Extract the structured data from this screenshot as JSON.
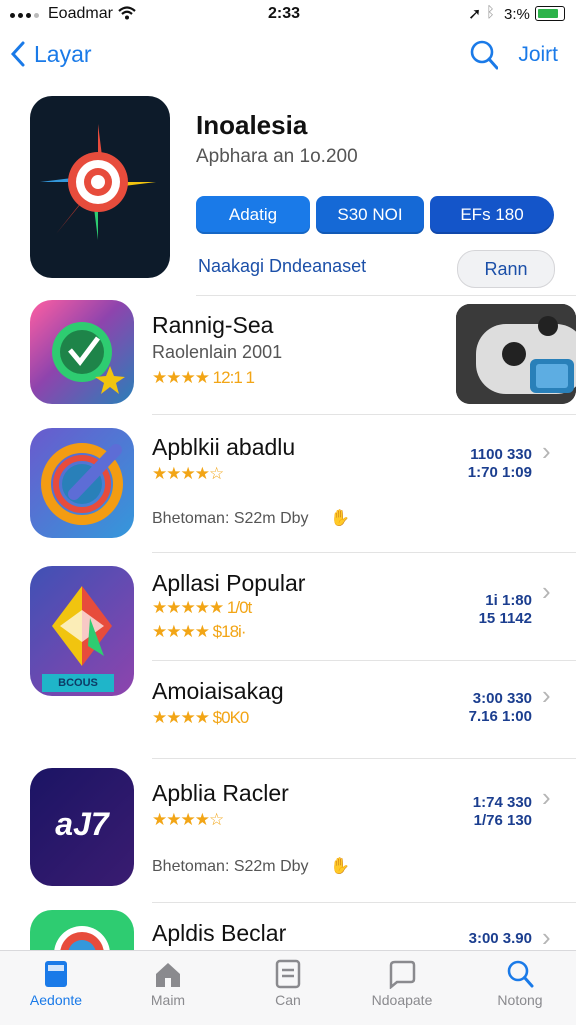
{
  "status_bar": {
    "carrier": "Eoadmar",
    "time": "2:33",
    "battery": "3:%"
  },
  "nav": {
    "back_label": "Layar",
    "right_label": "Joirt"
  },
  "featured": {
    "title": "Inoalesia",
    "subtitle": "Apbhara an 1o.200",
    "buttons": [
      "Adatig",
      "S30 NOI",
      "EFs 180"
    ],
    "link": "Naakagi Dndeanaset",
    "pill": "Rann"
  },
  "rows": [
    {
      "title": "Rannig-Sea",
      "subtitle": "Raolenlain 2001",
      "rating_text": "★★★★ 12:1 1"
    },
    {
      "title": "Apblkii abadlu",
      "rating_text": "★★★★☆",
      "meta": "Bhetoman: S22m Dby",
      "num1": "1100 330",
      "num2": "1:70 1:09"
    },
    {
      "title": "Apllasi Popular",
      "rating1": "★★★★★ 1/0t",
      "rating2": "★★★★ $18i·",
      "num1": "1i 1:80",
      "num2": "15 1142"
    },
    {
      "title": "Amoiaisakag",
      "rating_text": "★★★★ $0K0",
      "num1": "3:00 330",
      "num2": "7.16 1:00"
    },
    {
      "title": "Apblia Racler",
      "rating_text": "★★★★☆",
      "meta": "Bhetoman: S22m Dby",
      "num1": "1:74 330",
      "num2": "1/76 130"
    },
    {
      "title": "Apldis Beclar",
      "num1": "3:00 3.90"
    }
  ],
  "icon_text": {
    "row5": "aJ7",
    "row3_badge": "BCOUS"
  },
  "tabs": [
    "Aedonte",
    "Maim",
    "Can",
    "Ndoapate",
    "Notong"
  ],
  "colors": {
    "accent": "#1a7ae8",
    "star": "#f2a516",
    "number": "#1b3e8f"
  }
}
